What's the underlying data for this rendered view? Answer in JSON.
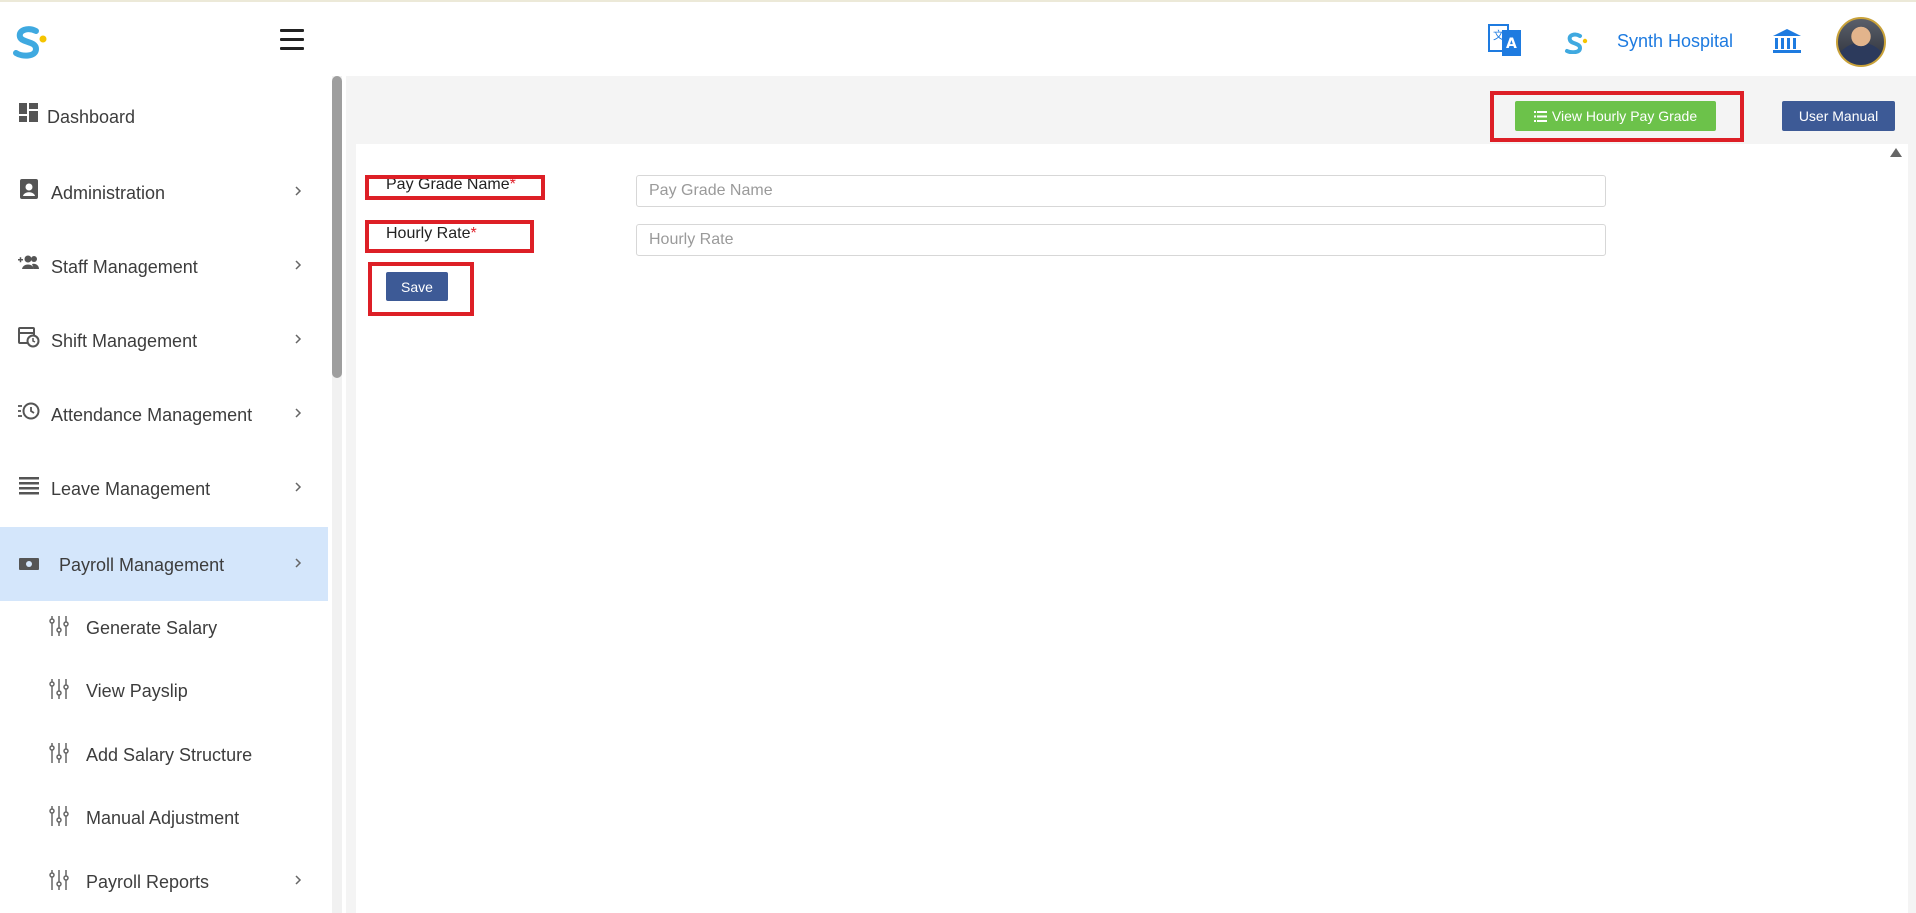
{
  "header": {
    "hospital_name": "Synth Hospital",
    "icons": [
      "logo-icon",
      "hamburger-icon",
      "translate-icon",
      "hospital-logo-icon",
      "bank-icon",
      "avatar"
    ]
  },
  "sidebar": {
    "items": [
      {
        "label": "Dashboard",
        "icon": "dashboard-icon"
      },
      {
        "label": "Administration",
        "icon": "contact-book-icon"
      },
      {
        "label": "Staff Management",
        "icon": "people-add-icon"
      },
      {
        "label": "Shift Management",
        "icon": "calendar-clock-icon"
      },
      {
        "label": "Attendance Management",
        "icon": "history-clock-icon"
      },
      {
        "label": "Leave Management",
        "icon": "list-icon"
      },
      {
        "label": "Payroll Management",
        "icon": "money-icon",
        "active": true
      }
    ],
    "payroll_subitems": [
      {
        "label": "Generate Salary"
      },
      {
        "label": "View Payslip"
      },
      {
        "label": "Add Salary Structure"
      },
      {
        "label": "Manual Adjustment"
      },
      {
        "label": "Payroll Reports"
      }
    ]
  },
  "toolbar": {
    "view_button": "View Hourly Pay Grade",
    "manual_button": "User Manual"
  },
  "form": {
    "pay_grade_label": "Pay Grade Name",
    "hourly_rate_label": "Hourly Rate",
    "required_mark": "*",
    "pay_grade_placeholder": "Pay Grade Name",
    "hourly_rate_placeholder": "Hourly Rate",
    "save_label": "Save"
  },
  "colors": {
    "accent_blue": "#3d5a96",
    "accent_green": "#6cc24a",
    "highlight_red": "#dd1f26",
    "active_bg": "#d4e6fb",
    "brand_blue": "#1e7be0"
  }
}
